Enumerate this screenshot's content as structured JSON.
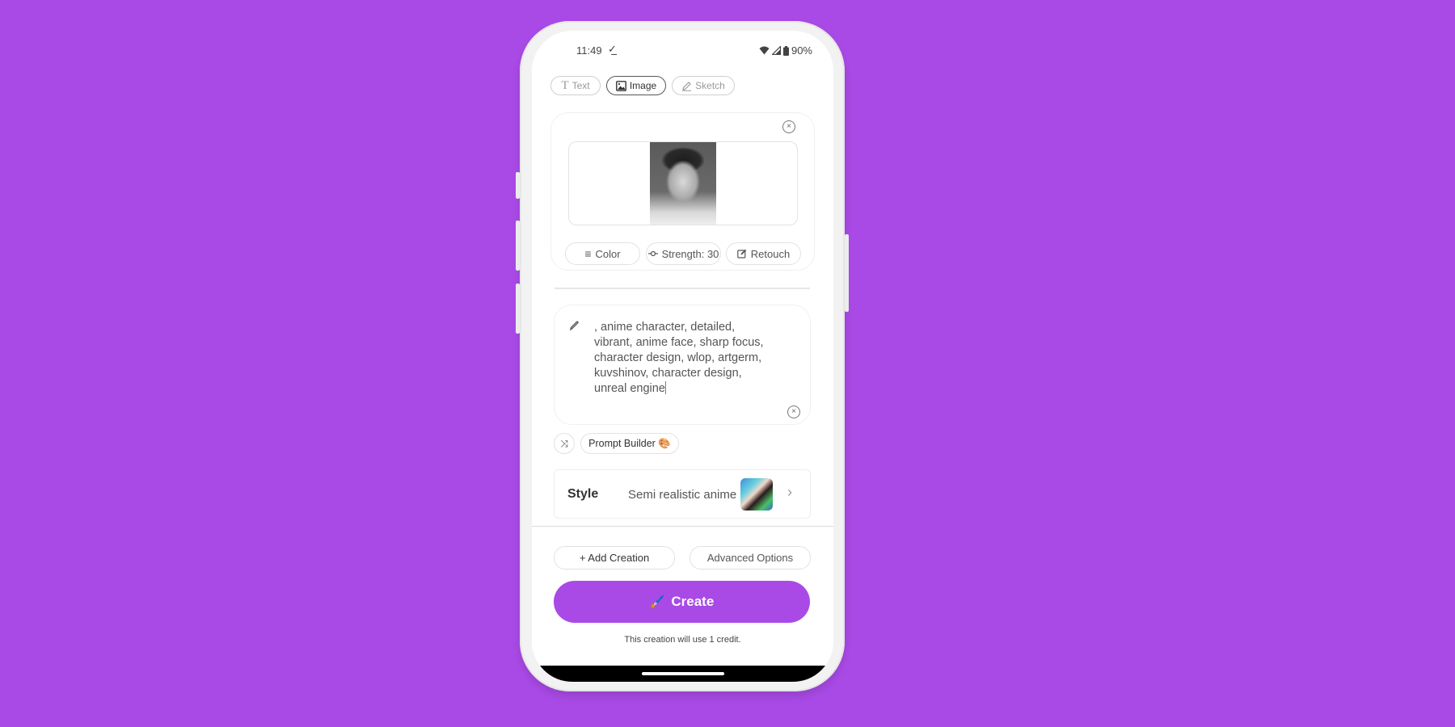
{
  "status_bar": {
    "time": "11:49",
    "battery": "90%"
  },
  "mode_tabs": [
    {
      "label": "Text",
      "icon": "text-icon",
      "active": false
    },
    {
      "label": "Image",
      "icon": "image-icon",
      "active": true
    },
    {
      "label": "Sketch",
      "icon": "pencil-icon",
      "active": false
    }
  ],
  "image_card": {
    "actions": {
      "color": "Color",
      "strength": "Strength: 30",
      "retouch": "Retouch"
    }
  },
  "prompt": {
    "value": ", anime character,  detailed,\nvibrant,  anime face,  sharp focus,\ncharacter design,  wlop,  artgerm,\nkuvshinov,  character design,\nunreal engine"
  },
  "prompt_builder": {
    "label": "Prompt Builder 🎨"
  },
  "style": {
    "label": "Style",
    "value": "Semi realistic anime"
  },
  "bottom": {
    "add_creation": "+ Add Creation",
    "advanced_options": "Advanced Options",
    "create": "Create",
    "create_emoji": "🖌️",
    "credit_note": "This creation will use 1 credit."
  },
  "colors": {
    "accent": "#a94ae6",
    "background": "#a94ae6"
  }
}
